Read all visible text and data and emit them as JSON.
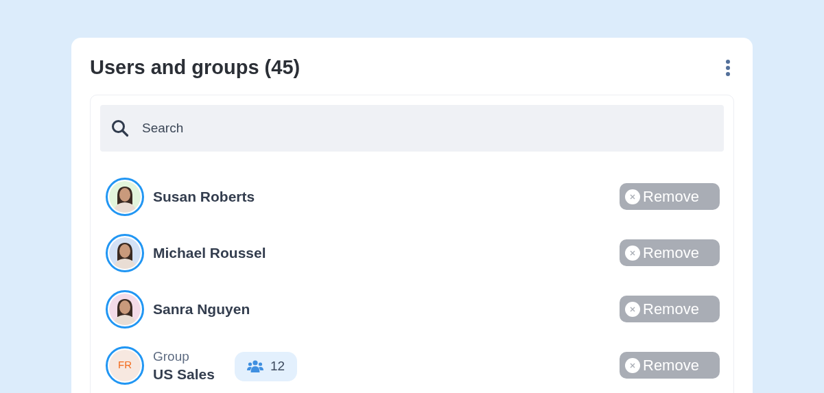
{
  "title": "Users and groups (45)",
  "search": {
    "placeholder": "Search"
  },
  "members": [
    {
      "kind": "user",
      "name": "Susan Roberts",
      "remove": {
        "label": "Remove",
        "disabled": true
      }
    },
    {
      "kind": "user",
      "name": "Michael Roussel",
      "remove": {
        "label": "Remove",
        "disabled": true
      }
    },
    {
      "kind": "user",
      "name": "Sanra Nguyen",
      "remove": {
        "label": "Remove",
        "disabled": true
      }
    },
    {
      "kind": "group",
      "type_label": "Group",
      "name": "US Sales",
      "initials": "FR",
      "count": "12",
      "remove": {
        "label": "Remove",
        "disabled": true
      }
    }
  ]
}
